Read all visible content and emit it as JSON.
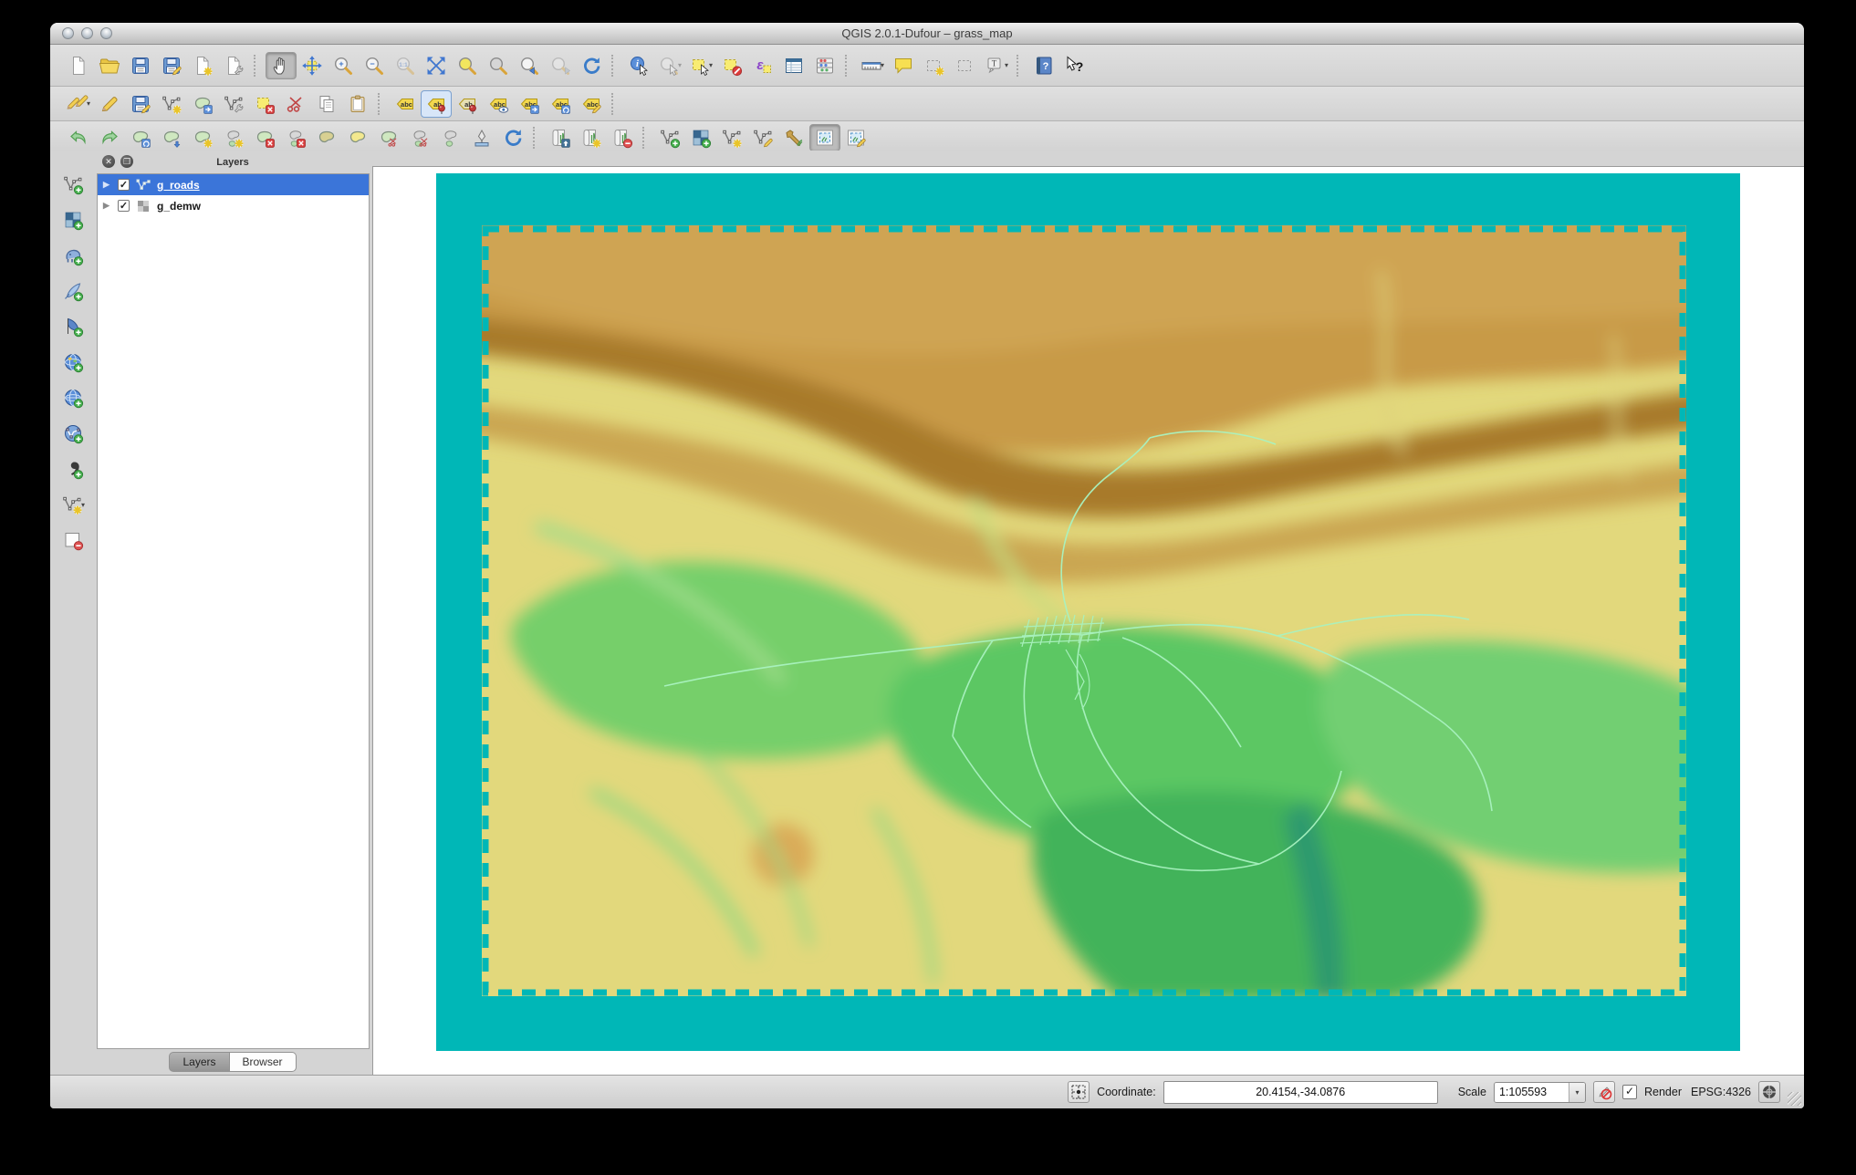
{
  "window": {
    "title": "QGIS 2.0.1-Dufour – grass_map"
  },
  "toolbars": {
    "row1": [
      {
        "n": "new-project",
        "b": "page"
      },
      {
        "n": "open-project",
        "b": "folder"
      },
      {
        "n": "save-project",
        "b": "floppy"
      },
      {
        "n": "save-project-as",
        "b": "floppy",
        "g": [
          "pencil"
        ]
      },
      {
        "n": "new-print-composer",
        "b": "page",
        "g": [
          "star"
        ]
      },
      {
        "n": "composer-manager",
        "b": "page",
        "g": [
          "wrench"
        ]
      },
      {
        "sep": true
      },
      {
        "n": "pan-map",
        "b": "hand",
        "st": "active"
      },
      {
        "n": "pan-to-selection",
        "b": "panarrows"
      },
      {
        "n": "zoom-in",
        "b": "magnifier",
        "t": "+"
      },
      {
        "n": "zoom-out",
        "b": "magnifier",
        "t": "−"
      },
      {
        "n": "zoom-native",
        "b": "magnifier",
        "t": "1:1",
        "st": "disabled"
      },
      {
        "n": "zoom-full",
        "b": "expand4"
      },
      {
        "n": "zoom-to-selection",
        "b": "magnifier",
        "c": "#f2e65e"
      },
      {
        "n": "zoom-to-layer",
        "b": "magnifier",
        "c": "#d6d6d6"
      },
      {
        "n": "zoom-last",
        "b": "magnifier",
        "g": [
          "left"
        ]
      },
      {
        "n": "zoom-next",
        "b": "magnifier",
        "g": [
          "right"
        ],
        "st": "disabled"
      },
      {
        "n": "refresh-map",
        "b": "refresh"
      },
      {
        "sep": true
      },
      {
        "n": "identify-features",
        "b": "info",
        "g": [
          "cursor"
        ]
      },
      {
        "n": "run-feature-action",
        "b": "magnifier",
        "g": [
          "cursor"
        ],
        "dd": true,
        "st": "disabled"
      },
      {
        "n": "select-features",
        "b": "selrect",
        "g": [
          "cursor"
        ],
        "dd": true
      },
      {
        "n": "deselect-all",
        "b": "selrect",
        "g": [
          "slash"
        ]
      },
      {
        "n": "select-by-expression",
        "b": "epsilon"
      },
      {
        "n": "open-attribute-table",
        "b": "table"
      },
      {
        "n": "field-calculator",
        "b": "abacus"
      },
      {
        "sep": true
      },
      {
        "n": "measure",
        "b": "ruler",
        "dd": true
      },
      {
        "n": "map-tips",
        "b": "speech"
      },
      {
        "n": "new-bookmark",
        "b": "dashedrect",
        "g": [
          "star"
        ]
      },
      {
        "n": "show-bookmarks",
        "b": "dashedrect"
      },
      {
        "n": "text-annotation",
        "b": "textbubble",
        "dd": true
      },
      {
        "sep": true
      },
      {
        "n": "help-contents",
        "b": "book"
      },
      {
        "n": "whats-this",
        "b": "whatsthis"
      }
    ],
    "row2": [
      {
        "n": "current-edits",
        "b": "pencils2",
        "dd": true
      },
      {
        "n": "toggle-editing",
        "b": "pencil"
      },
      {
        "n": "save-layer-edits",
        "b": "floppy",
        "g": [
          "pencil"
        ]
      },
      {
        "n": "add-feature",
        "b": "nodes",
        "g": [
          "star"
        ]
      },
      {
        "n": "move-feature",
        "b": "blob",
        "g": [
          "arrow"
        ]
      },
      {
        "n": "node-tool",
        "b": "nodes",
        "g": [
          "wrench"
        ]
      },
      {
        "n": "delete-selected",
        "b": "selrect",
        "g": [
          "x"
        ]
      },
      {
        "n": "cut-features",
        "b": "scissors"
      },
      {
        "n": "copy-features",
        "b": "docs2"
      },
      {
        "n": "paste-features",
        "b": "clipboard"
      },
      {
        "sep": true
      },
      {
        "n": "layer-labeling-options",
        "b": "tag",
        "t": "abc"
      },
      {
        "n": "pin-unpin-labels",
        "b": "tag",
        "t": "ab",
        "g": [
          "pin"
        ],
        "st": "framed"
      },
      {
        "n": "highlight-pinned-labels",
        "b": "tag",
        "t": "ab",
        "g": [
          "pin"
        ],
        "c": "#e6dfb2"
      },
      {
        "n": "show-hide-labels",
        "b": "tag",
        "t": "abc",
        "g": [
          "eye"
        ]
      },
      {
        "n": "move-label",
        "b": "tag",
        "t": "abc",
        "g": [
          "arrow"
        ]
      },
      {
        "n": "rotate-label",
        "b": "tag",
        "t": "abc",
        "g": [
          "rotate"
        ]
      },
      {
        "n": "change-label",
        "b": "tag",
        "t": "abc",
        "g": [
          "pencil"
        ]
      },
      {
        "sep": true
      }
    ],
    "row3": [
      {
        "n": "undo",
        "b": "undo"
      },
      {
        "n": "redo",
        "b": "redo"
      },
      {
        "n": "rotate-feature",
        "b": "blob",
        "g": [
          "rotate"
        ]
      },
      {
        "n": "simplify-feature",
        "b": "blob",
        "g": [
          "down"
        ]
      },
      {
        "n": "add-ring",
        "b": "blob",
        "g": [
          "star"
        ]
      },
      {
        "n": "add-part",
        "b": "blob2",
        "g": [
          "star"
        ]
      },
      {
        "n": "delete-ring",
        "b": "blob",
        "g": [
          "x"
        ]
      },
      {
        "n": "delete-part",
        "b": "blob2",
        "g": [
          "x"
        ]
      },
      {
        "n": "fill-ring",
        "b": "blob",
        "c": "#d8d092"
      },
      {
        "n": "offset-curve",
        "b": "blob",
        "c": "#f2e88e"
      },
      {
        "n": "split-features",
        "b": "blob",
        "g": [
          "scissors"
        ]
      },
      {
        "n": "split-parts",
        "b": "blob2",
        "g": [
          "scissors"
        ]
      },
      {
        "n": "merge-features",
        "b": "blob2"
      },
      {
        "n": "reshape-features",
        "b": "inkpen"
      },
      {
        "n": "rotate-point-symbols",
        "b": "refresh"
      },
      {
        "sep": true
      },
      {
        "n": "open-mapset",
        "b": "scroll",
        "g": [
          "up"
        ]
      },
      {
        "n": "new-mapset",
        "b": "scroll",
        "g": [
          "star"
        ]
      },
      {
        "n": "close-mapset",
        "b": "scroll",
        "g": [
          "minus"
        ]
      },
      {
        "sep": true
      },
      {
        "n": "add-grass-vector-layer",
        "b": "nodes",
        "g": [
          "plus"
        ]
      },
      {
        "n": "add-grass-raster-layer",
        "b": "checker",
        "g": [
          "plus"
        ]
      },
      {
        "n": "create-grass-vector",
        "b": "nodes",
        "g": [
          "star"
        ]
      },
      {
        "n": "edit-grass-vector",
        "b": "nodes",
        "g": [
          "pencil"
        ]
      },
      {
        "n": "open-grass-tools",
        "b": "hammer"
      },
      {
        "n": "display-grass-region",
        "b": "region",
        "st": "active"
      },
      {
        "n": "edit-grass-region",
        "b": "region",
        "g": [
          "pencil"
        ]
      }
    ],
    "side": [
      {
        "n": "add-vector-layer",
        "b": "nodes",
        "g": [
          "plus"
        ]
      },
      {
        "n": "add-raster-layer",
        "b": "checker",
        "g": [
          "plus"
        ]
      },
      {
        "n": "add-postgis-layer",
        "b": "elephant",
        "g": [
          "plus"
        ]
      },
      {
        "n": "add-spatialite-layer",
        "b": "feather",
        "g": [
          "plus"
        ]
      },
      {
        "n": "add-mssql-layer",
        "b": "sail",
        "g": [
          "plus"
        ]
      },
      {
        "n": "add-wms-layer",
        "b": "globe",
        "g": [
          "plus"
        ]
      },
      {
        "n": "add-wcs-layer",
        "b": "globe2",
        "g": [
          "plus"
        ]
      },
      {
        "n": "add-wfs-layer",
        "b": "globev",
        "g": [
          "plus"
        ]
      },
      {
        "n": "add-delimited-text-layer",
        "b": "comma",
        "g": [
          "plus"
        ]
      },
      {
        "n": "new-shapefile-layer",
        "b": "nodes",
        "g": [
          "star"
        ],
        "dd": true
      },
      {
        "n": "remove-layer",
        "b": "square",
        "g": [
          "minus"
        ]
      }
    ]
  },
  "layers_panel": {
    "title": "Layers",
    "close_glyph": "✕",
    "float_glyph": "❐",
    "layers": [
      {
        "label": "g_roads",
        "checked": true,
        "selected": true,
        "type": "vector"
      },
      {
        "label": "g_demw",
        "checked": true,
        "selected": false,
        "type": "raster"
      }
    ],
    "tabs": [
      {
        "label": "Layers",
        "active": true
      },
      {
        "label": "Browser",
        "active": false
      }
    ]
  },
  "map": {
    "region_color": "#00b7b7",
    "dem_base_color": "#e2d87c",
    "roads_color": "#a9f2c0"
  },
  "status_bar": {
    "coordinate_label": "Coordinate:",
    "coordinate_value": "20.4154,-34.0876",
    "scale_label": "Scale",
    "scale_value": "1:105593",
    "render_label": "Render",
    "render_checked": true,
    "crs_text": "EPSG:4326",
    "render_check_glyph": "✓"
  }
}
